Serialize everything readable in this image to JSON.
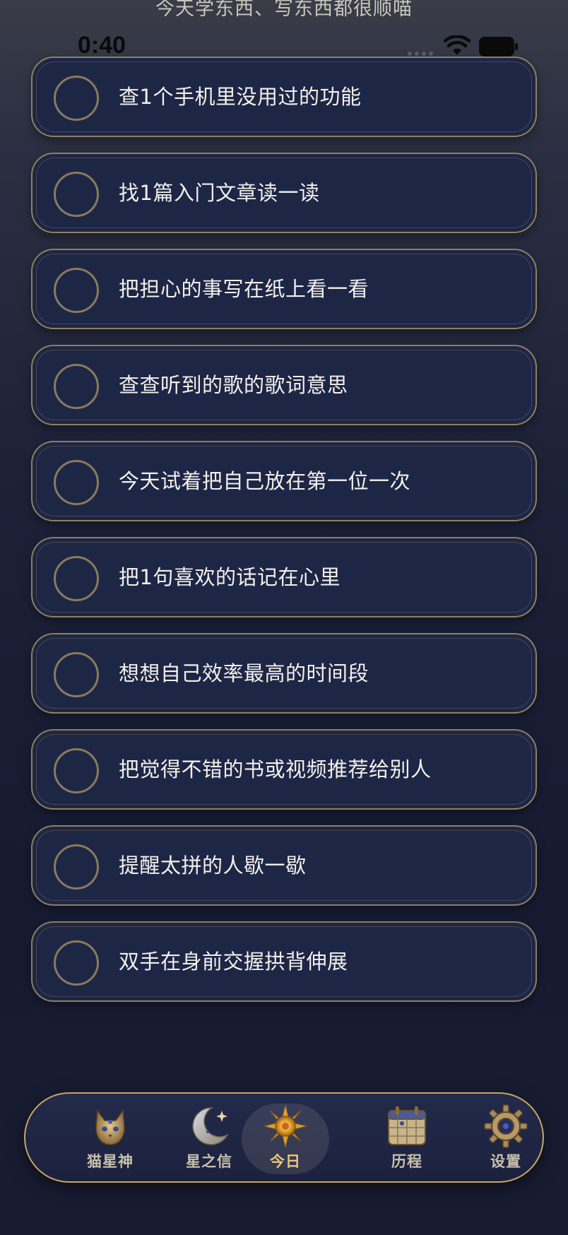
{
  "header": {
    "caption": "今天学东西、写东西都很顺喵"
  },
  "status_bar": {
    "time": "0:40"
  },
  "tasks": [
    {
      "label": "查1个手机里没用过的功能",
      "done": false
    },
    {
      "label": "找1篇入门文章读一读",
      "done": false
    },
    {
      "label": "把担心的事写在纸上看一看",
      "done": false
    },
    {
      "label": "查查听到的歌的歌词意思",
      "done": false
    },
    {
      "label": "今天试着把自己放在第一位一次",
      "done": false
    },
    {
      "label": "把1句喜欢的话记在心里",
      "done": false
    },
    {
      "label": "想想自己效率最高的时间段",
      "done": false
    },
    {
      "label": "把觉得不错的书或视频推荐给别人",
      "done": false
    },
    {
      "label": "提醒太拼的人歇一歇",
      "done": false
    },
    {
      "label": "双手在身前交握拱背伸展",
      "done": false
    }
  ],
  "tab_bar": {
    "items": [
      {
        "label": "猫星神",
        "icon": "cat-icon"
      },
      {
        "label": "星之信",
        "icon": "moon-icon"
      },
      {
        "label": "今日",
        "icon": "sun-icon",
        "active": true
      },
      {
        "label": "历程",
        "icon": "calendar-icon"
      },
      {
        "label": "设置",
        "icon": "gear-icon"
      }
    ]
  },
  "colors": {
    "card_bg": "#1e2646",
    "card_border": "#8f7f5c",
    "accent_gold": "#e9c67a",
    "text": "#f3f1ec"
  }
}
